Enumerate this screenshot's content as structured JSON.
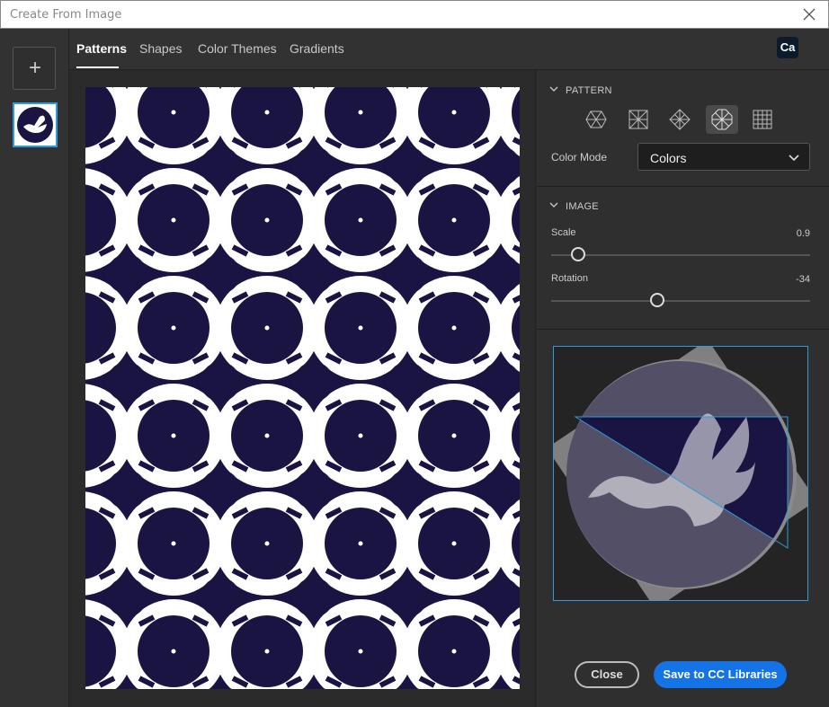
{
  "window": {
    "title": "Create From Image"
  },
  "tabs": [
    {
      "label": "Patterns"
    },
    {
      "label": "Shapes"
    },
    {
      "label": "Color Themes"
    },
    {
      "label": "Gradients"
    }
  ],
  "badge": {
    "label": "Ca"
  },
  "pattern_section": {
    "heading": "PATTERN",
    "modes": [
      "hexagon-icon",
      "square-grid-icon",
      "diamond-icon",
      "octagon-icon",
      "grid-icon"
    ],
    "selected_mode": "octagon-icon",
    "color_mode_label": "Color Mode",
    "color_mode_value": "Colors"
  },
  "image_section": {
    "heading": "IMAGE",
    "scale_label": "Scale",
    "scale_value": "0.9",
    "rotation_label": "Rotation",
    "rotation_value": "-34"
  },
  "actions": {
    "close_label": "Close",
    "save_label": "Save to CC Libraries"
  },
  "colors": {
    "accent": "#1473e6",
    "selection": "#2d9cdb",
    "pattern_dark": "#1a1442",
    "pattern_light": "#ffffff"
  }
}
